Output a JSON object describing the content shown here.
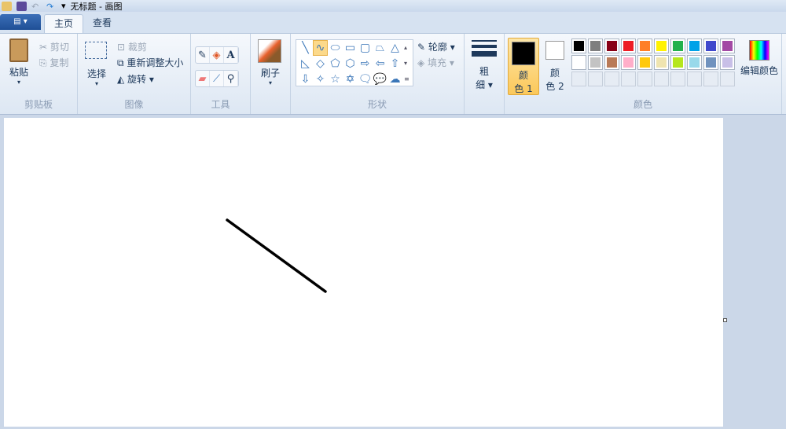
{
  "window": {
    "title": "无标题 - 画图"
  },
  "tabs": [
    {
      "label": "主页",
      "active": true
    },
    {
      "label": "查看",
      "active": false
    }
  ],
  "clipboard": {
    "paste": "粘贴",
    "cut": "剪切",
    "copy": "复制",
    "group": "剪贴板"
  },
  "image": {
    "select": "选择",
    "crop": "裁剪",
    "resize": "重新调整大小",
    "rotate": "旋转",
    "group": "图像"
  },
  "tools": {
    "group": "工具",
    "icons": [
      "pencil-icon",
      "fill-icon",
      "text-icon",
      "eraser-icon",
      "color-picker-icon",
      "magnifier-icon"
    ]
  },
  "brushes": {
    "label": "刷子"
  },
  "shapes": {
    "group": "形状",
    "outline": "轮廓",
    "fill": "填充",
    "items": [
      "╲",
      "∿",
      "⬭",
      "▭",
      "▢",
      "⏢",
      "△",
      "◺",
      "◇",
      "⬠",
      "⬡",
      "⇨",
      "⇦",
      "⇧",
      "⇩",
      "✧",
      "☆",
      "✡",
      "🗨",
      "💬",
      "☁"
    ]
  },
  "size": {
    "label1": "粗",
    "label2": "细"
  },
  "colors": {
    "group": "颜色",
    "color1_l1": "颜",
    "color1_l2": "色 1",
    "color2_l1": "颜",
    "color2_l2": "色 2",
    "edit": "编辑颜色",
    "color1": "#000000",
    "color2": "#ffffff",
    "palette_row1": [
      "#000000",
      "#7f7f7f",
      "#880015",
      "#ed1c24",
      "#ff7f27",
      "#fff200",
      "#22b14c",
      "#00a2e8",
      "#3f48cc",
      "#a349a4"
    ],
    "palette_row2": [
      "#ffffff",
      "#c3c3c3",
      "#b97a57",
      "#ffaec9",
      "#ffc90e",
      "#efe4b0",
      "#b5e61d",
      "#99d9ea",
      "#7092be",
      "#c8bfe7"
    ]
  }
}
